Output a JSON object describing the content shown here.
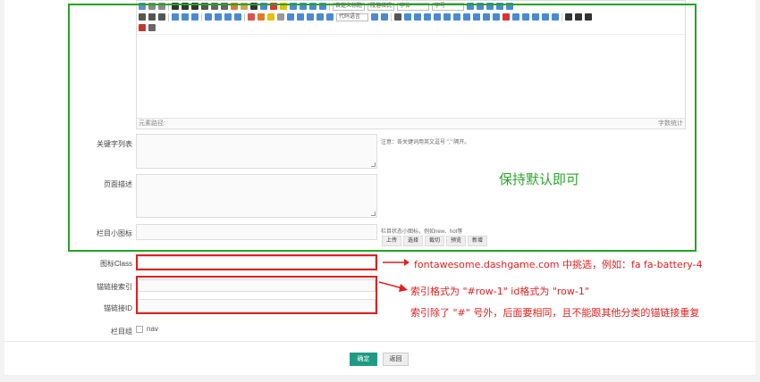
{
  "editor": {
    "status_path": "元素路径:",
    "status_count": "字数统计",
    "toolbar": {
      "select_paragraph": "自定义标题",
      "select_format": "段落格式",
      "select_font": "字体",
      "select_size": "字号",
      "select_code": "代码语言"
    }
  },
  "fields": {
    "keywords_label": "关键字列表",
    "keywords_note": "注意：各关键词用英文逗号 \",\" 隔开。",
    "description_label": "页面描述",
    "icon_label": "栏目小图标",
    "icon_note": "栏目状态小图标，例如new、hot等",
    "icon_buttons": [
      "上传",
      "选择",
      "裁切",
      "预览",
      "新增"
    ],
    "icon_class_label": "图标Class",
    "anchor_index_label": "锚链接索引",
    "anchor_id_label": "锚链接ID",
    "group_label": "栏目组",
    "group_option": "nav"
  },
  "annotations": {
    "keep_default": "保持默认即可",
    "icon_class_hint": "fontawesome.dashgame.com 中挑选，例如：fa fa-battery-4",
    "anchor_format": "索引格式为 \"#row-1\"  id格式为 \"row-1\"",
    "anchor_rule": "索引除了 \"#\" 号外，后面要相同，且不能跟其他分类的锚链接重复"
  },
  "actions": {
    "confirm": "确定",
    "back": "返回"
  }
}
